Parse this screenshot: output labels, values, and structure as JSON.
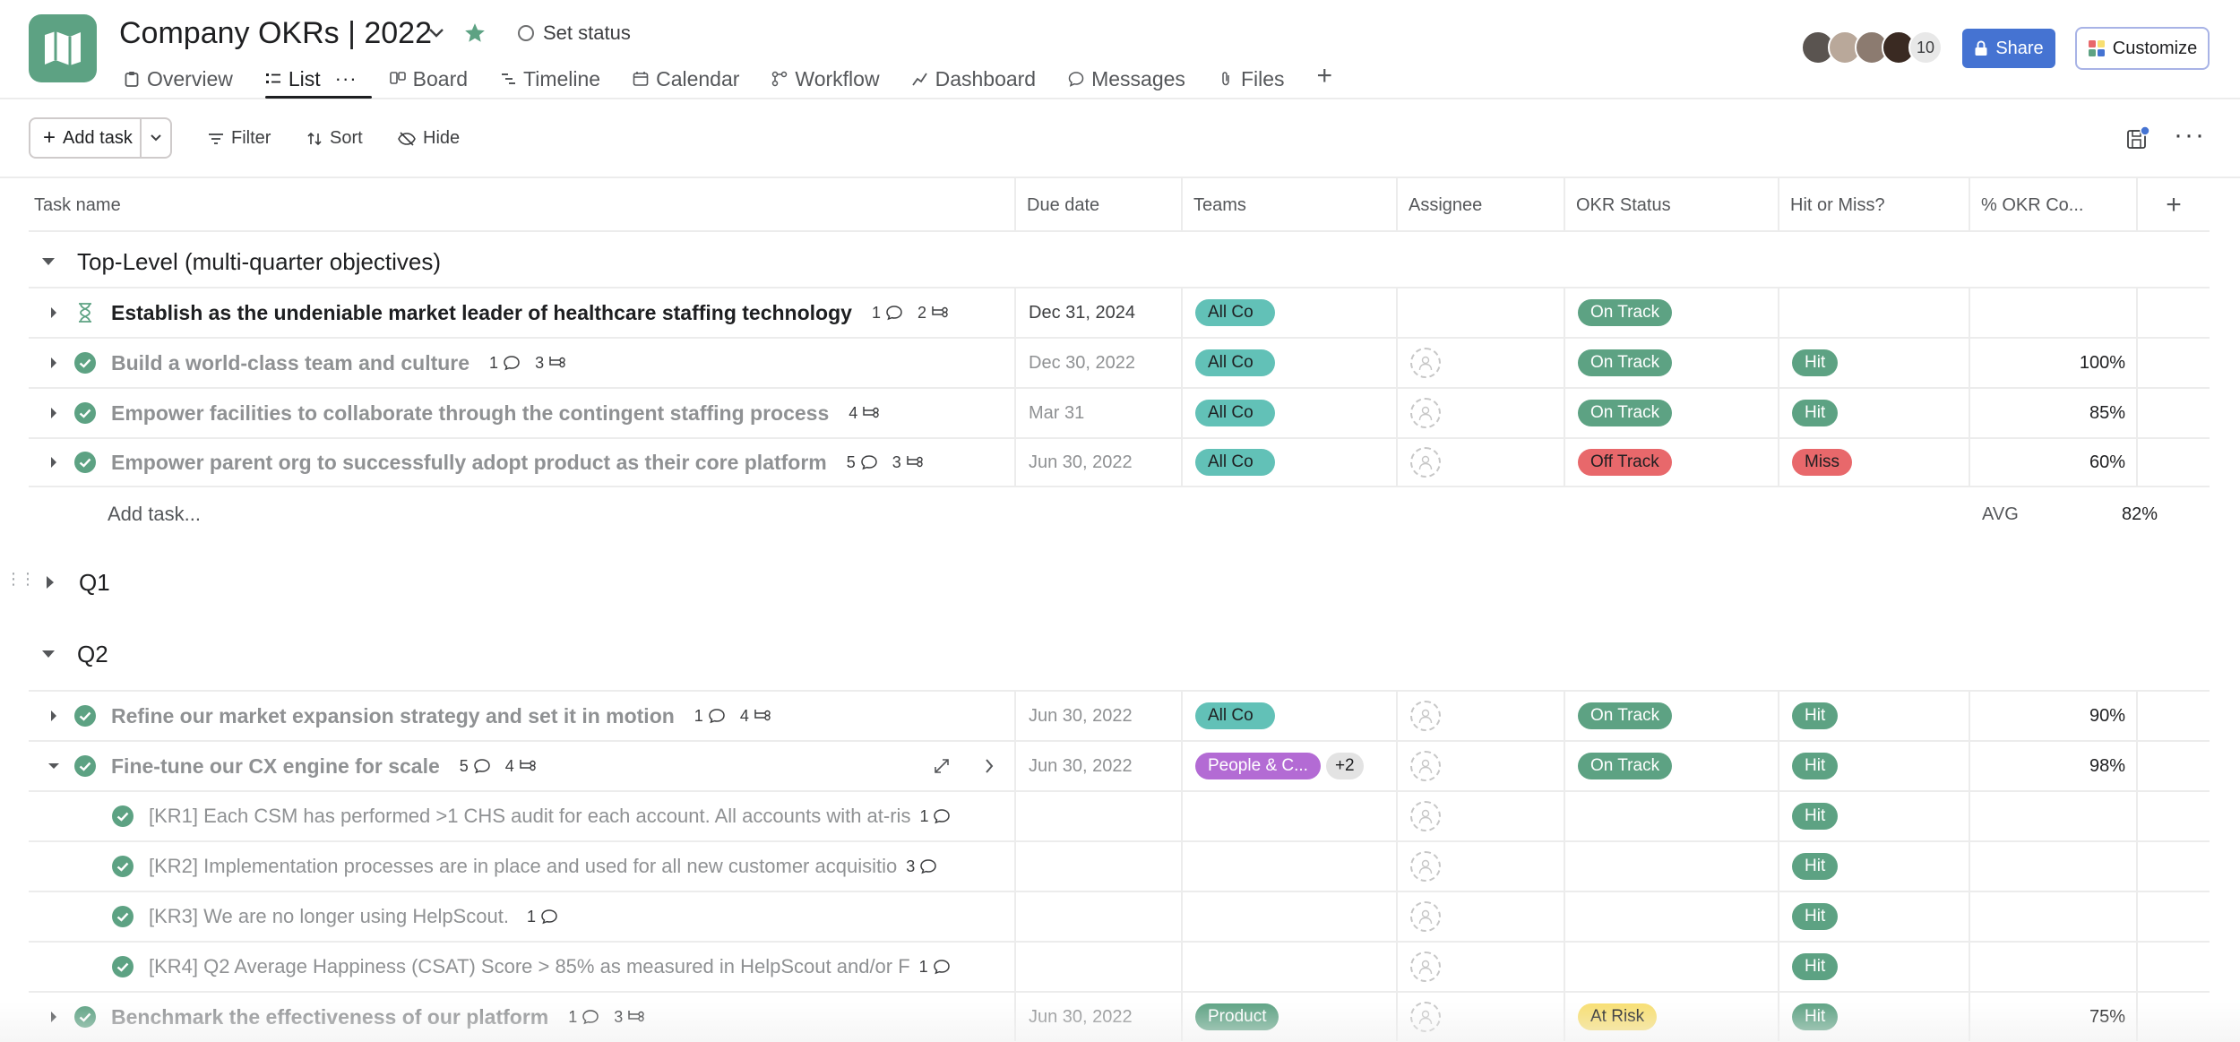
{
  "project": {
    "title": "Company OKRs | 2022",
    "set_status": "Set status"
  },
  "tabs": [
    {
      "label": "Overview",
      "icon": "clipboard-icon"
    },
    {
      "label": "List",
      "icon": "list-icon"
    },
    {
      "label": "Board",
      "icon": "board-icon"
    },
    {
      "label": "Timeline",
      "icon": "timeline-icon"
    },
    {
      "label": "Calendar",
      "icon": "calendar-icon"
    },
    {
      "label": "Workflow",
      "icon": "workflow-icon"
    },
    {
      "label": "Dashboard",
      "icon": "dashboard-icon"
    },
    {
      "label": "Messages",
      "icon": "message-icon"
    },
    {
      "label": "Files",
      "icon": "paperclip-icon"
    }
  ],
  "header": {
    "member_count": "10",
    "share_label": "Share",
    "customize_label": "Customize"
  },
  "toolbar": {
    "add_task": "Add task",
    "filter": "Filter",
    "sort": "Sort",
    "hide": "Hide"
  },
  "columns": [
    "Task name",
    "Due date",
    "Teams",
    "Assignee",
    "OKR Status",
    "Hit or Miss?",
    "% OKR Co...",
    "+"
  ],
  "sections": {
    "top": "Top-Level (multi-quarter objectives)",
    "q1": "Q1",
    "q2": "Q2"
  },
  "rows": {
    "r1": {
      "name": "Establish as the undeniable market leader of healthcare staffing technology",
      "comments": "1",
      "subtasks": "2",
      "due": "Dec 31, 2024",
      "team": "All Co",
      "status": "On Track",
      "hit": "",
      "pct": ""
    },
    "r2": {
      "name": "Build a world-class team and culture",
      "comments": "1",
      "subtasks": "3",
      "due": "Dec 30, 2022",
      "team": "All Co",
      "status": "On Track",
      "hit": "Hit",
      "pct": "100%"
    },
    "r3": {
      "name": "Empower facilities to collaborate through the contingent staffing process",
      "subtasks": "4",
      "due": "Mar 31",
      "team": "All Co",
      "status": "On Track",
      "hit": "Hit",
      "pct": "85%"
    },
    "r4": {
      "name": "Empower parent org to successfully adopt product as their core platform",
      "comments": "5",
      "subtasks": "3",
      "due": "Jun 30, 2022",
      "team": "All Co",
      "status": "Off Track",
      "hit": "Miss",
      "pct": "60%"
    },
    "q2r1": {
      "name": "Refine our market expansion strategy and set it in motion",
      "comments": "1",
      "subtasks": "4",
      "due": "Jun 30, 2022",
      "team": "All Co",
      "status": "On Track",
      "hit": "Hit",
      "pct": "90%"
    },
    "q2r2": {
      "name": "Fine-tune our CX engine for scale",
      "comments": "5",
      "subtasks": "4",
      "due": "Jun 30, 2022",
      "team": "People & C...",
      "team_extra": "+2",
      "status": "On Track",
      "hit": "Hit",
      "pct": "98%"
    },
    "kr1": {
      "name": "[KR1] Each CSM has performed >1 CHS audit for each account. All accounts with at-ris",
      "comments": "1",
      "hit": "Hit"
    },
    "kr2": {
      "name": "[KR2] Implementation processes are in place and used for all new customer acquisitio",
      "comments": "3",
      "hit": "Hit"
    },
    "kr3": {
      "name": "[KR3] We are no longer using HelpScout.",
      "comments": "1",
      "hit": "Hit"
    },
    "kr4": {
      "name": "[KR4] Q2 Average Happiness (CSAT) Score > 85% as measured in HelpScout and/or F",
      "comments": "1",
      "hit": "Hit"
    },
    "q2r3": {
      "name": "Benchmark the effectiveness of our platform",
      "comments": "1",
      "subtasks": "3",
      "due": "Jun 30, 2022",
      "team": "Product",
      "status": "At Risk",
      "hit": "Hit",
      "pct": "75%"
    }
  },
  "add_task_row": {
    "label": "Add task...",
    "avg_label": "AVG",
    "avg_value": "82%"
  },
  "colors": {
    "accent_green": "#5da283",
    "share_blue": "#4573d2",
    "team_teal": "#62c1b7",
    "off_track_red": "#e8686b",
    "at_risk_yellow": "#f8df72",
    "people_purple": "#b36bd4"
  }
}
